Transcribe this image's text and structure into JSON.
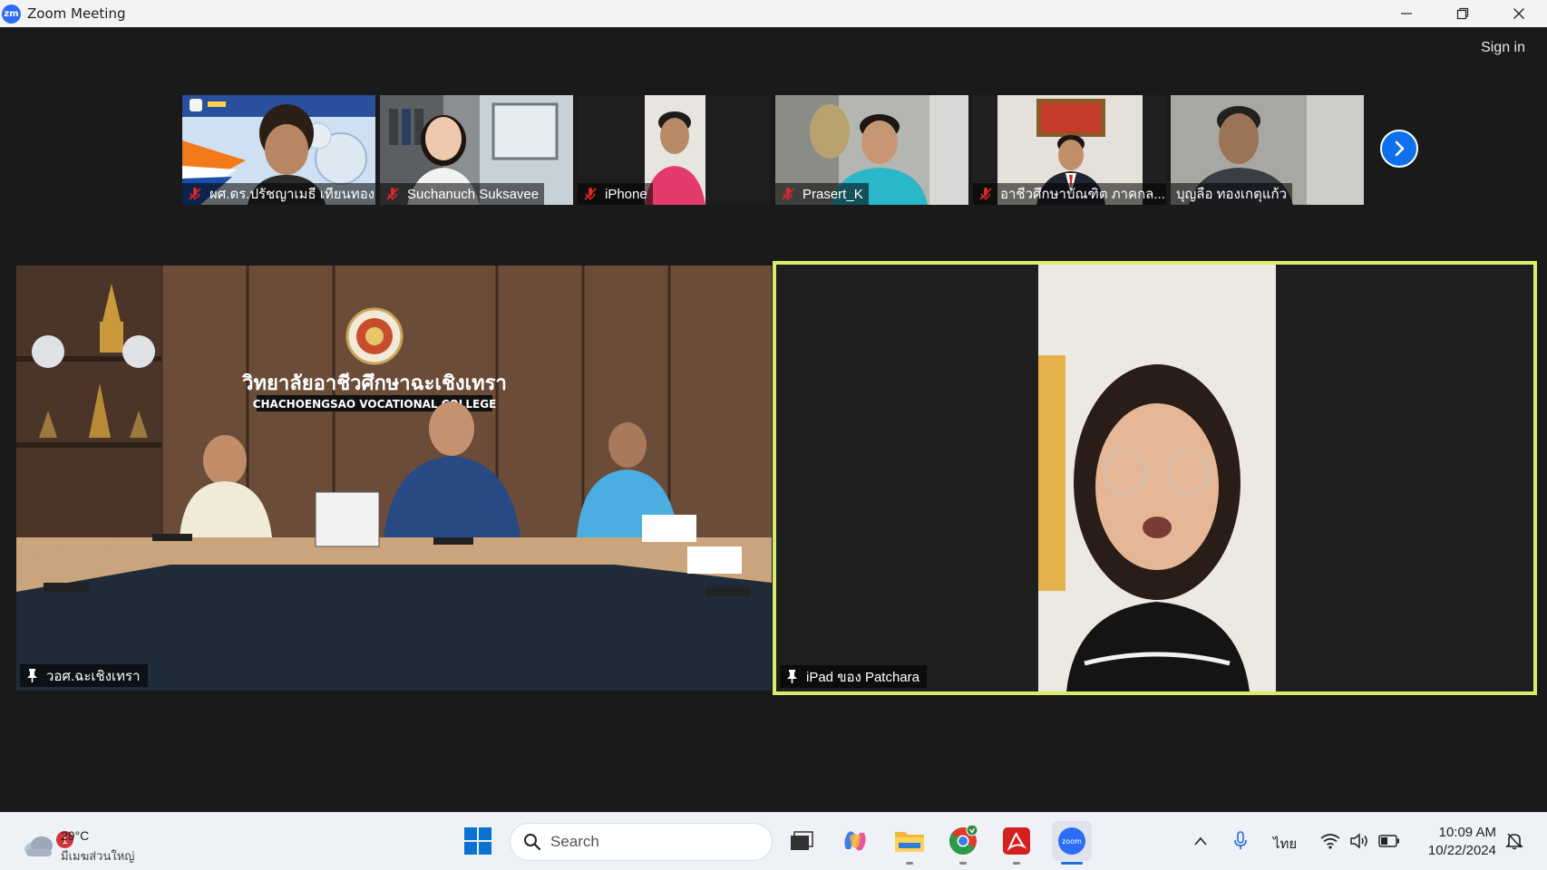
{
  "window": {
    "title": "Zoom Meeting",
    "app_icon_text": "zm"
  },
  "meeting": {
    "sign_in_label": "Sign in",
    "participants_strip": [
      {
        "name": "ผศ.ดร.ปรัชญาเมธี เทียนทอง",
        "muted": true
      },
      {
        "name": "Suchanuch Suksavee",
        "muted": true
      },
      {
        "name": "iPhone",
        "muted": true
      },
      {
        "name": "Prasert_K",
        "muted": true
      },
      {
        "name": "อาชีวศึกษาบัณฑิต ภาคกล...",
        "muted": true
      },
      {
        "name": "บุญลือ ทองเกตุแก้ว",
        "muted": false
      }
    ],
    "main_tiles": [
      {
        "name": "วอศ.ฉะเชิงเทรา",
        "pinned": true,
        "sign_thai": "วิทยาลัยอาชีวศึกษาฉะเชิงเทรา",
        "sign_english": "CHACHOENGSAO VOCATIONAL COLLEGE"
      },
      {
        "name": "iPad ของ Patchara",
        "pinned": true,
        "active_speaker": true
      }
    ],
    "colors": {
      "active_speaker_border": "#d9ec6b",
      "muted_icon": "#e02828",
      "next_button": "#0e71eb"
    }
  },
  "taskbar": {
    "weather": {
      "temperature": "29°C",
      "description": "มีเมฆส่วนใหญ่",
      "badge_count": "1"
    },
    "search_placeholder": "Search",
    "apps": [
      "windows-start",
      "search",
      "task-view",
      "copilot",
      "file-explorer",
      "chrome",
      "acrobat",
      "zoom"
    ],
    "tray": {
      "language": "ไทย",
      "time": "10:09 AM",
      "date": "10/22/2024"
    }
  }
}
